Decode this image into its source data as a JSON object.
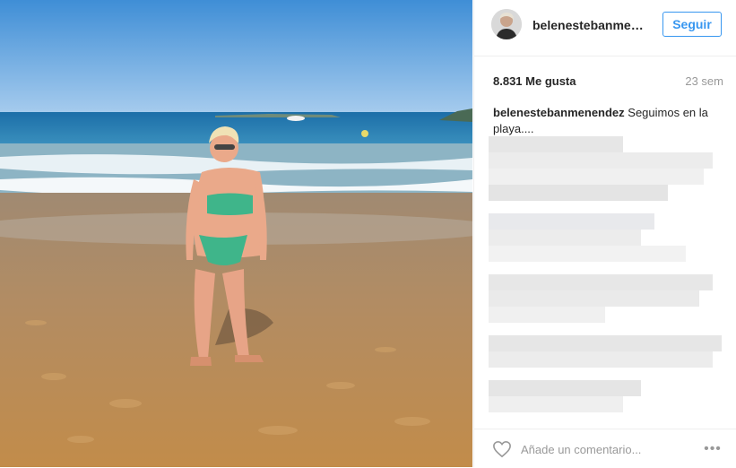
{
  "post": {
    "username": "belenestebanmenendez",
    "follow_label": "Seguir",
    "likes": "8.831 Me gusta",
    "time_ago": "23 sem",
    "caption_user": "belenestebanmenendez",
    "caption_text": "Seguimos en la playa....",
    "comment_placeholder": "Añade un comentario...",
    "more_label": "•••"
  },
  "icons": {
    "like": "heart-icon",
    "options": "more-options-icon"
  },
  "colors": {
    "accent": "#3897f0",
    "text": "#262626",
    "muted": "#999999"
  }
}
